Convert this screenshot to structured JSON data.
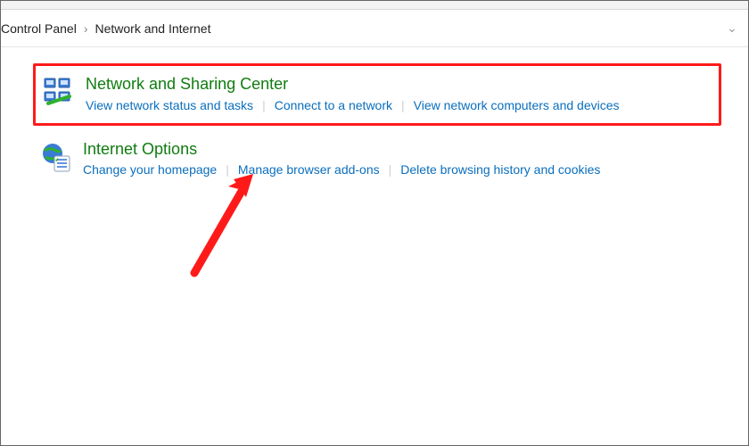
{
  "breadcrumb": {
    "items": [
      "Control Panel",
      "Network and Internet"
    ]
  },
  "sections": {
    "network_sharing": {
      "title": "Network and Sharing Center",
      "links": {
        "status": "View network status and tasks",
        "connect": "Connect to a network",
        "devices": "View network computers and devices"
      }
    },
    "internet_options": {
      "title": "Internet Options",
      "links": {
        "homepage": "Change your homepage",
        "addons": "Manage browser add-ons",
        "history": "Delete browsing history and cookies"
      }
    }
  },
  "colors": {
    "title_green": "#107c10",
    "link_blue": "#0a6ebd",
    "highlight_red": "#ff1a1a"
  }
}
